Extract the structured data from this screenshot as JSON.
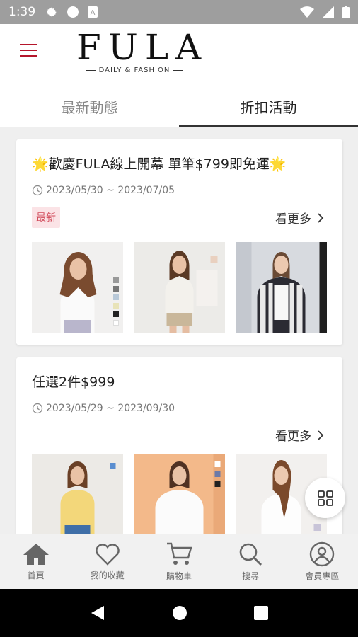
{
  "status_bar": {
    "time": "1:39"
  },
  "header": {
    "brand": "FULA",
    "tagline": "DAILY & FASHION"
  },
  "tabs": [
    {
      "label": "最新動態",
      "active": false
    },
    {
      "label": "折扣活動",
      "active": true
    }
  ],
  "cards": [
    {
      "title": "🌟歡慶FULA線上開幕 單筆$799即免運🌟",
      "date": "2023/05/30 ~ 2023/07/05",
      "badge": "最新",
      "more_label": "看更多"
    },
    {
      "title": "任選2件$999",
      "date": "2023/05/29 ~ 2023/09/30",
      "more_label": "看更多"
    }
  ],
  "bottom_nav": [
    {
      "label": "首頁",
      "icon": "home-icon"
    },
    {
      "label": "我的收藏",
      "icon": "heart-icon"
    },
    {
      "label": "購物車",
      "icon": "cart-icon"
    },
    {
      "label": "搜尋",
      "icon": "search-icon"
    },
    {
      "label": "會員專區",
      "icon": "user-icon"
    }
  ],
  "colors": {
    "accent": "#b5162b",
    "badge_bg": "#fbe3e6",
    "badge_text": "#d14a5a"
  }
}
